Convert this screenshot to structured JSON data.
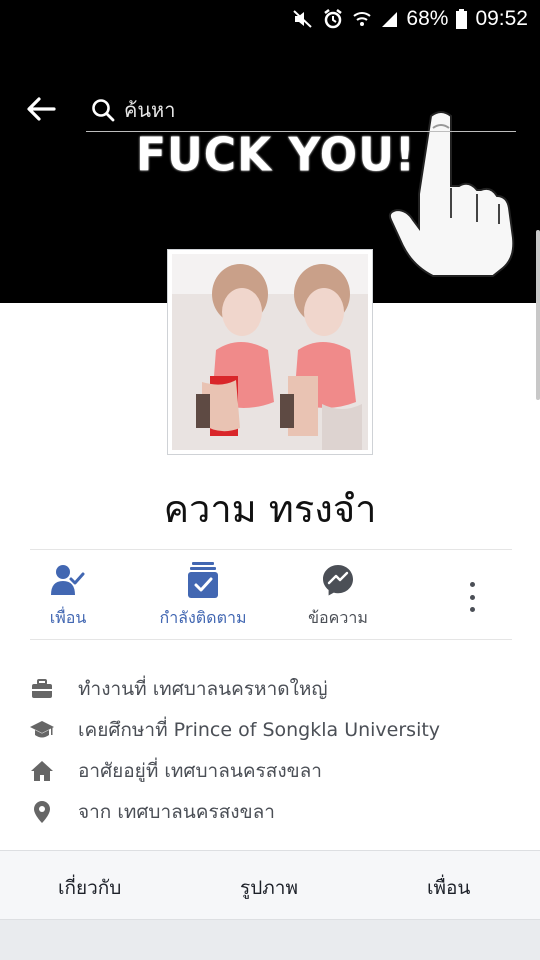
{
  "status_bar": {
    "battery": "68%",
    "time": "09:52"
  },
  "search": {
    "placeholder": "ค้นหา"
  },
  "cover": {
    "text": "FUCK YOU!"
  },
  "profile": {
    "name": "ความ ทรงจำ"
  },
  "actions": [
    {
      "label": "เพื่อน",
      "icon": "friends-check-icon"
    },
    {
      "label": "กำลังติดตาม",
      "icon": "following-check-icon"
    },
    {
      "label": "ข้อความ",
      "icon": "messenger-icon"
    }
  ],
  "intro": [
    {
      "icon": "briefcase-icon",
      "text": "ทำงานที่ เทศบาลนครหาดใหญ่"
    },
    {
      "icon": "graduation-cap-icon",
      "text": "เคยศึกษาที่ Prince of Songkla University"
    },
    {
      "icon": "home-icon",
      "text": "อาศัยอยู่ที่ เทศบาลนครสงขลา"
    },
    {
      "icon": "location-pin-icon",
      "text": "จาก เทศบาลนครสงขลา"
    }
  ],
  "tabs": [
    "เกี่ยวกับ",
    "รูปภาพ",
    "เพื่อน"
  ],
  "colors": {
    "accent": "#4267b2",
    "text_secondary": "#4b4f56",
    "cover_bg": "#000000"
  }
}
